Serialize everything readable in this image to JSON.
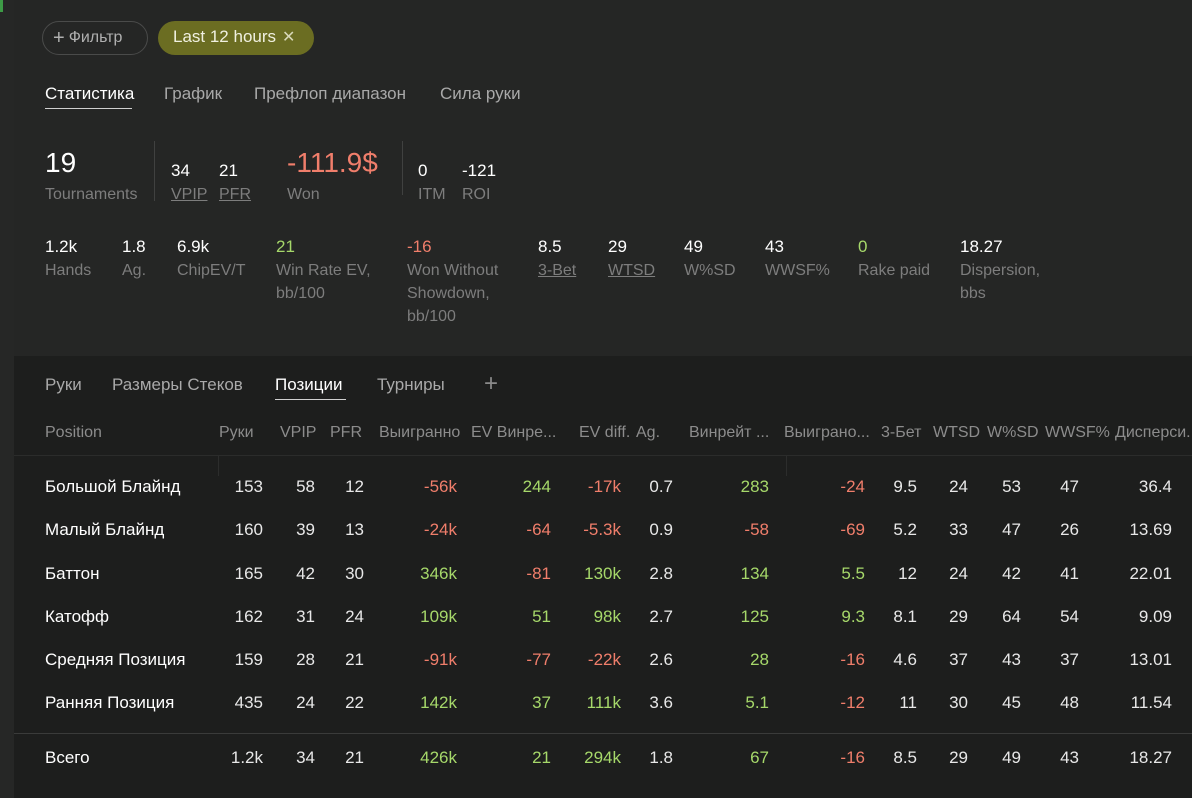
{
  "filters": {
    "add_label": "Фильтр",
    "active_label": "Last 12 hours"
  },
  "tabs": [
    "Статистика",
    "График",
    "Префлоп диапазон",
    "Сила руки"
  ],
  "summary": {
    "tournaments": {
      "value": "19",
      "label": "Tournaments"
    },
    "vpip": {
      "value": "34",
      "label": "VPIP"
    },
    "pfr": {
      "value": "21",
      "label": "PFR"
    },
    "won": {
      "value": "-111.9$",
      "label": "Won"
    },
    "itm": {
      "value": "0",
      "label": "ITM"
    },
    "roi": {
      "value": "-121",
      "label": "ROI"
    }
  },
  "stats": {
    "hands": {
      "value": "1.2k",
      "label": "Hands"
    },
    "ag": {
      "value": "1.8",
      "label": "Ag."
    },
    "chipev": {
      "value": "6.9k",
      "label": "ChipEV/T"
    },
    "winrate": {
      "value": "21",
      "label1": "Win Rate EV,",
      "label2": "bb/100"
    },
    "wws": {
      "value": "-16",
      "label1": "Won Without",
      "label2": "Showdown,",
      "label3": "bb/100"
    },
    "threebet": {
      "value": "8.5",
      "label": "3-Bet"
    },
    "wtsd": {
      "value": "29",
      "label": "WTSD"
    },
    "wsd": {
      "value": "49",
      "label": "W%SD"
    },
    "wwsf": {
      "value": "43",
      "label": "WWSF%"
    },
    "rake": {
      "value": "0",
      "label": "Rake paid"
    },
    "dispersion": {
      "value": "18.27",
      "label1": "Dispersion,",
      "label2": "bbs"
    }
  },
  "bottom_tabs": [
    "Руки",
    "Размеры Стеков",
    "Позиции",
    "Турниры"
  ],
  "table": {
    "headers": [
      "Position",
      "Руки",
      "VPIP",
      "PFR",
      "Выигранно",
      "EV Винре...",
      "EV diff.",
      "Ag.",
      "Винрейт ...",
      "Выиграно...",
      "3-Бет",
      "WTSD",
      "W%SD",
      "WWSF%",
      "Дисперси..."
    ],
    "rows": [
      {
        "name": "Большой Блайнд",
        "hands": "153",
        "vpip": "58",
        "pfr": "12",
        "won": "-56k",
        "evwr": "244",
        "evdiff": "-17k",
        "ag": "0.7",
        "wr": "283",
        "wons": "-24",
        "tb": "9.5",
        "wtsd": "24",
        "wsd": "53",
        "wwsf": "47",
        "disp": "36.4"
      },
      {
        "name": "Малый Блайнд",
        "hands": "160",
        "vpip": "39",
        "pfr": "13",
        "won": "-24k",
        "evwr": "-64",
        "evdiff": "-5.3k",
        "ag": "0.9",
        "wr": "-58",
        "wons": "-69",
        "tb": "5.2",
        "wtsd": "33",
        "wsd": "47",
        "wwsf": "26",
        "disp": "13.69"
      },
      {
        "name": "Баттон",
        "hands": "165",
        "vpip": "42",
        "pfr": "30",
        "won": "346k",
        "evwr": "-81",
        "evdiff": "130k",
        "ag": "2.8",
        "wr": "134",
        "wons": "5.5",
        "tb": "12",
        "wtsd": "24",
        "wsd": "42",
        "wwsf": "41",
        "disp": "22.01"
      },
      {
        "name": "Катофф",
        "hands": "162",
        "vpip": "31",
        "pfr": "24",
        "won": "109k",
        "evwr": "51",
        "evdiff": "98k",
        "ag": "2.7",
        "wr": "125",
        "wons": "9.3",
        "tb": "8.1",
        "wtsd": "29",
        "wsd": "64",
        "wwsf": "54",
        "disp": "9.09"
      },
      {
        "name": "Средняя Позиция",
        "hands": "159",
        "vpip": "28",
        "pfr": "21",
        "won": "-91k",
        "evwr": "-77",
        "evdiff": "-22k",
        "ag": "2.6",
        "wr": "28",
        "wons": "-16",
        "tb": "4.6",
        "wtsd": "37",
        "wsd": "43",
        "wwsf": "37",
        "disp": "13.01"
      },
      {
        "name": "Ранняя Позиция",
        "hands": "435",
        "vpip": "24",
        "pfr": "22",
        "won": "142k",
        "evwr": "37",
        "evdiff": "111k",
        "ag": "3.6",
        "wr": "5.1",
        "wons": "-12",
        "tb": "11",
        "wtsd": "30",
        "wsd": "45",
        "wwsf": "48",
        "disp": "11.54"
      }
    ],
    "total": {
      "name": "Всего",
      "hands": "1.2k",
      "vpip": "34",
      "pfr": "21",
      "won": "426k",
      "evwr": "21",
      "evdiff": "294k",
      "ag": "1.8",
      "wr": "67",
      "wons": "-16",
      "tb": "8.5",
      "wtsd": "29",
      "wsd": "49",
      "wwsf": "43",
      "disp": "18.27"
    }
  },
  "colors": {
    "positive": "#a6d86a",
    "negative": "#f07e6b",
    "chip_active": "#6b6d22"
  }
}
